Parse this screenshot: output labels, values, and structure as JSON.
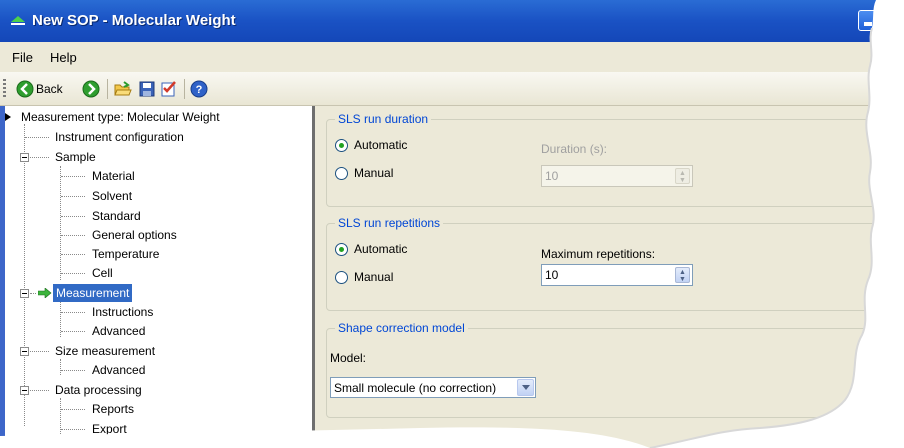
{
  "window": {
    "title": "New SOP - Molecular Weight"
  },
  "menu": [
    "File",
    "Help"
  ],
  "toolbar": {
    "back_label": "Back",
    "icons": [
      "back-icon",
      "forward-icon",
      "open-folder-icon",
      "save-icon",
      "checklist-icon",
      "help-icon"
    ]
  },
  "tree": {
    "root": "Measurement type: Molecular Weight",
    "items": [
      {
        "label": "Instrument configuration"
      },
      {
        "label": "Sample"
      },
      {
        "label": "Material"
      },
      {
        "label": "Solvent"
      },
      {
        "label": "Standard"
      },
      {
        "label": "General options"
      },
      {
        "label": "Temperature"
      },
      {
        "label": "Cell"
      },
      {
        "label": "Measurement"
      },
      {
        "label": "Instructions"
      },
      {
        "label": "Advanced"
      },
      {
        "label": "Size measurement"
      },
      {
        "label": "Advanced"
      },
      {
        "label": "Data processing"
      },
      {
        "label": "Reports"
      },
      {
        "label": "Export"
      }
    ],
    "selected": "Measurement"
  },
  "sls_duration": {
    "title": "SLS run duration",
    "option_auto": "Automatic",
    "option_manual": "Manual",
    "selected": "Automatic",
    "duration_label": "Duration (s):",
    "duration_value": "10"
  },
  "sls_repetitions": {
    "title": "SLS run repetitions",
    "option_auto": "Automatic",
    "option_manual": "Manual",
    "selected": "Automatic",
    "max_label": "Maximum repetitions:",
    "max_value": "10"
  },
  "shape_correction": {
    "title": "Shape correction model",
    "model_label": "Model:",
    "model_value": "Small molecule (no correction)"
  },
  "colors": {
    "titlebar": "#1a52c4",
    "group_title": "#0046d5",
    "selection": "#316ac5",
    "panel_bg": "#ece9d8"
  }
}
